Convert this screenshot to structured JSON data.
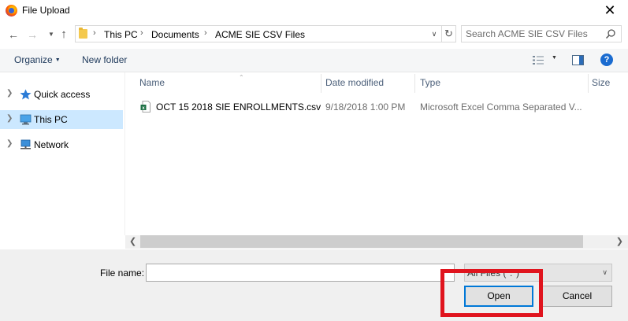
{
  "window": {
    "title": "File Upload",
    "close_glyph": "✕"
  },
  "navbar": {
    "breadcrumbs": [
      "This PC",
      "Documents",
      "ACME SIE CSV Files"
    ],
    "crumb_separator": "›",
    "search_placeholder": "Search ACME SIE CSV Files"
  },
  "toolbar": {
    "organize_label": "Organize",
    "new_folder_label": "New folder",
    "help_glyph": "?"
  },
  "navpane": {
    "items": [
      {
        "label": "Quick access",
        "icon": "star-icon",
        "selected": false
      },
      {
        "label": "This PC",
        "icon": "computer-icon",
        "selected": true
      },
      {
        "label": "Network",
        "icon": "network-icon",
        "selected": false
      }
    ]
  },
  "filelist": {
    "columns": [
      "Name",
      "Date modified",
      "Type",
      "Size"
    ],
    "files": [
      {
        "name": "OCT 15 2018 SIE ENROLLMENTS.csv",
        "date_modified": "9/18/2018 1:00 PM",
        "type": "Microsoft Excel Comma Separated V...",
        "icon": "excel-csv-icon"
      }
    ]
  },
  "footer": {
    "file_name_label": "File name:",
    "file_name_value": "",
    "filter_value": "All Files (*.*)",
    "open_label": "Open",
    "cancel_label": "Cancel"
  },
  "annotation": {
    "highlight_color": "#e0141e",
    "target": "open-button"
  }
}
